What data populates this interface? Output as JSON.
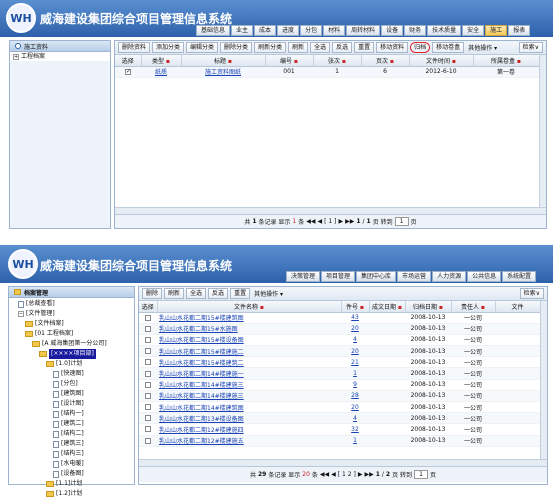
{
  "top": {
    "brand": "威海建设集团综合项目管理信息系统",
    "logo": "WH",
    "nav_tabs": [
      "基础信息",
      "业主",
      "成本",
      "进度",
      "分包",
      "材料",
      "周转材料",
      "设备",
      "财务",
      "技术质量",
      "安全",
      "施工",
      "报表"
    ],
    "active_tab": "施工",
    "sidebar_title": "施工资料",
    "tree_item": "工程档案",
    "toolbar": [
      "删除资料",
      "添加分类",
      "编辑分类",
      "删除分类",
      "刷新分类",
      "刷新",
      "全选",
      "反选",
      "重置",
      "移动资料",
      "归档",
      "移动卷盒"
    ],
    "toolbar_more": "其他操作",
    "toolbar_search": "检索",
    "columns": [
      "选择",
      "类型",
      "标题",
      "编号",
      "张次",
      "页次",
      "文件时间",
      "所属卷盒"
    ],
    "rows": [
      {
        "type": "纸质",
        "title": "施工资料图纸",
        "no": "001",
        "sheet": "1",
        "page": "6",
        "date": "2012-6-10",
        "box": "第一卷"
      }
    ],
    "pager": {
      "prefix": "共",
      "total": "1",
      "mid": "条记录 显示",
      "size": "1",
      "unit": "条",
      "current": "[ 1 ]",
      "page": "1",
      "pages": "1",
      "goto": "页 转到",
      "gopage": "1",
      "end": "页"
    }
  },
  "bottom": {
    "brand": "威海建设集团综合项目管理信息系统",
    "logo": "WH",
    "nav_tabs": [
      "决策管理",
      "项目管理",
      "集团中心库",
      "市场运营",
      "人力资源",
      "公共信息",
      "系统配置"
    ],
    "sidebar_title": "档案管理",
    "tree": [
      {
        "label": "[总裁查看]",
        "depth": 1,
        "kind": "doc"
      },
      {
        "label": "[文件管理]",
        "depth": 1,
        "kind": "box"
      },
      {
        "label": "[文件档案]",
        "depth": 2,
        "kind": "fold"
      },
      {
        "label": "[01 工程档案]",
        "depth": 2,
        "kind": "fold"
      },
      {
        "label": "[A 威海集团第一分公司]",
        "depth": 3,
        "kind": "fold"
      },
      {
        "label": "[××××项目部]",
        "depth": 4,
        "kind": "fold",
        "selected": true
      },
      {
        "label": "[1.0]计划",
        "depth": 5,
        "kind": "fold"
      },
      {
        "label": "[快速图]",
        "depth": 6,
        "kind": "doc"
      },
      {
        "label": "[分包]",
        "depth": 6,
        "kind": "doc"
      },
      {
        "label": "[建筑图]",
        "depth": 6,
        "kind": "doc"
      },
      {
        "label": "[设计图]",
        "depth": 6,
        "kind": "doc"
      },
      {
        "label": "[结构一]",
        "depth": 6,
        "kind": "doc"
      },
      {
        "label": "[建筑二]",
        "depth": 6,
        "kind": "doc"
      },
      {
        "label": "[结构二]",
        "depth": 6,
        "kind": "doc"
      },
      {
        "label": "[建筑三]",
        "depth": 6,
        "kind": "doc"
      },
      {
        "label": "[结构三]",
        "depth": 6,
        "kind": "doc"
      },
      {
        "label": "[水电暖]",
        "depth": 6,
        "kind": "doc"
      },
      {
        "label": "[设备图]",
        "depth": 6,
        "kind": "doc"
      },
      {
        "label": "[1.1]计划",
        "depth": 5,
        "kind": "fold"
      },
      {
        "label": "[1.2]计划",
        "depth": 5,
        "kind": "fold"
      }
    ],
    "toolbar": [
      "删除",
      "刷新",
      "全选",
      "反选",
      "重置"
    ],
    "toolbar_more": "其他操作",
    "toolbar_search": "检索",
    "columns": [
      "选择",
      "文件名称",
      "件号",
      "成文日期",
      "归档日期",
      "责任人",
      "文件"
    ],
    "rows": [
      {
        "name": "乳山山水花都二期15#楼建筑图",
        "no": "43",
        "date": "2008-10-13",
        "owner": "一公司"
      },
      {
        "name": "乳山山水花都二期15#水施图",
        "no": "20",
        "date": "2008-10-13",
        "owner": "一公司"
      },
      {
        "name": "乳山山水花都二期15#楼设备图",
        "no": "4",
        "date": "2008-10-13",
        "owner": "一公司"
      },
      {
        "name": "乳山山水花都二期15#楼建施二",
        "no": "20",
        "date": "2008-10-13",
        "owner": "一公司"
      },
      {
        "name": "乳山山水花都二期15#楼建筑二",
        "no": "21",
        "date": "2008-10-13",
        "owner": "一公司"
      },
      {
        "name": "乳山山水花都二期14#楼建施一",
        "no": "1",
        "date": "2008-10-13",
        "owner": "一公司"
      },
      {
        "name": "乳山山水花都二期14#楼建施三",
        "no": "9",
        "date": "2008-10-13",
        "owner": "一公司"
      },
      {
        "name": "乳山山水花都二期14#楼建施三",
        "no": "28",
        "date": "2008-10-13",
        "owner": "一公司"
      },
      {
        "name": "乳山山水花都二期14#楼建筑图",
        "no": "20",
        "date": "2008-10-13",
        "owner": "一公司"
      },
      {
        "name": "乳山山水花都二期13#楼设备图",
        "no": "4",
        "date": "2008-10-13",
        "owner": "一公司"
      },
      {
        "name": "乳山山水花都二期12#楼建施四",
        "no": "32",
        "date": "2008-10-13",
        "owner": "一公司"
      },
      {
        "name": "乳山山水花都二期12#楼建施五",
        "no": "1",
        "date": "2008-10-13",
        "owner": "一公司"
      }
    ],
    "pager": {
      "prefix": "共",
      "total": "29",
      "mid": "条记录 显示",
      "size": "20",
      "unit": "条",
      "current": "[ 1 2 ]",
      "page": "1",
      "pages": "2",
      "goto": "页 转到",
      "gopage": "1",
      "end": "页"
    }
  }
}
